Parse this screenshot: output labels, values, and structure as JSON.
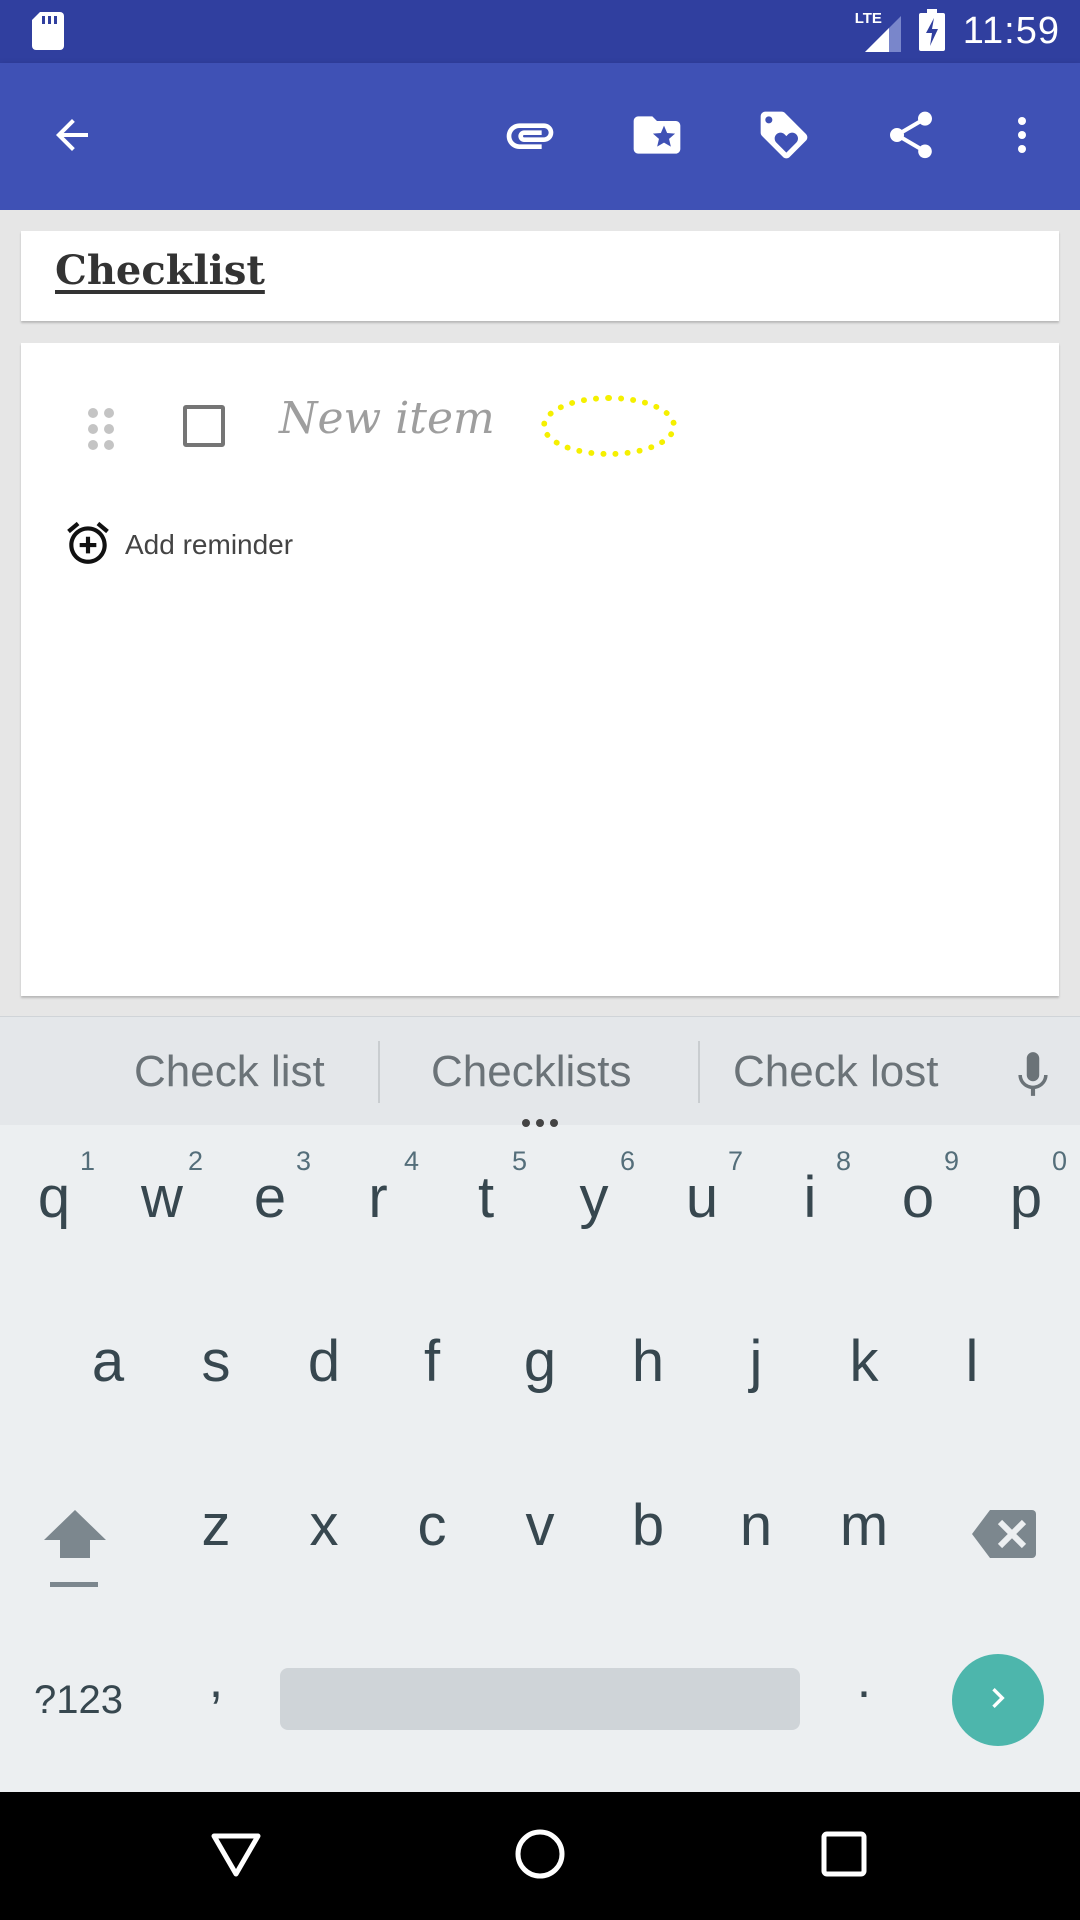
{
  "status_bar": {
    "time": "11:59",
    "network": "LTE"
  },
  "app_bar": {
    "icons": [
      "arrow-back-icon",
      "paperclip-icon",
      "folder-star-icon",
      "tag-heart-icon",
      "share-icon",
      "more-vert-icon"
    ]
  },
  "note": {
    "title": "Checklist",
    "item_placeholder": "New item",
    "reminder_label": "Add reminder"
  },
  "keyboard": {
    "suggestions": [
      "Check list",
      "Checklists",
      "Check lost"
    ],
    "row1": [
      "q",
      "w",
      "e",
      "r",
      "t",
      "y",
      "u",
      "i",
      "o",
      "p"
    ],
    "row1_numbers": [
      "1",
      "2",
      "3",
      "4",
      "5",
      "6",
      "7",
      "8",
      "9",
      "0"
    ],
    "row2": [
      "a",
      "s",
      "d",
      "f",
      "g",
      "h",
      "j",
      "k",
      "l"
    ],
    "row3": [
      "z",
      "x",
      "c",
      "v",
      "b",
      "n",
      "m"
    ],
    "symbols_label": "?123",
    "comma": ",",
    "period": ".",
    "accent_color": "#4db6ac"
  },
  "colors": {
    "primary": "#3F51B5",
    "primary_dark": "#303F9F"
  }
}
